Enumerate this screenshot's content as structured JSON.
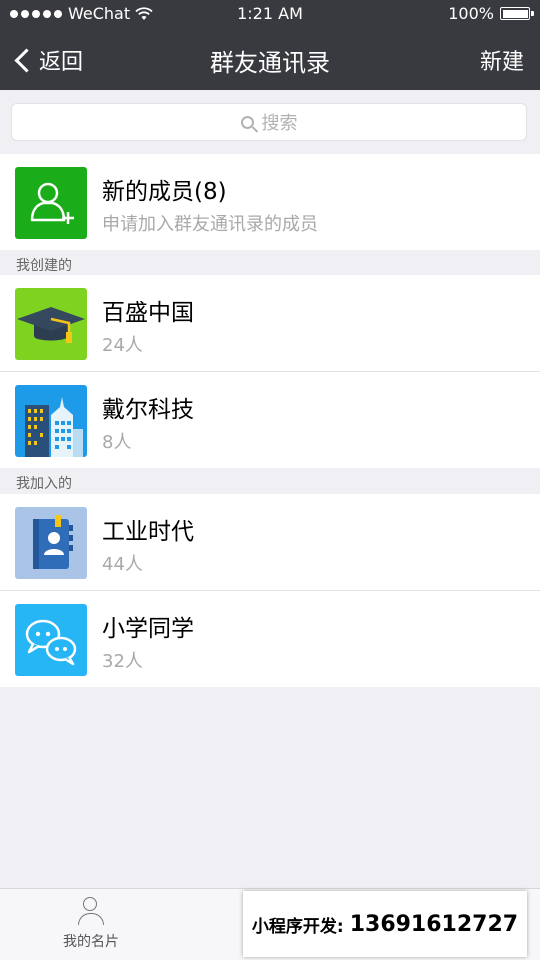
{
  "status": {
    "carrier": "WeChat",
    "time": "1:21 AM",
    "battery": "100%"
  },
  "nav": {
    "back": "返回",
    "title": "群友通讯录",
    "new": "新建"
  },
  "search": {
    "placeholder": "搜索"
  },
  "new_members": {
    "title": "新的成员(8)",
    "subtitle": "申请加入群友通讯录的成员",
    "icon": "add-person-icon",
    "color": "#1aad19"
  },
  "sections": {
    "created": {
      "label": "我创建的",
      "items": [
        {
          "name": "百盛中国",
          "count": "24人",
          "icon": "graduation-cap-icon",
          "color": "#7ed321"
        },
        {
          "name": "戴尔科技",
          "count": "8人",
          "icon": "city-buildings-icon",
          "color": "#1e9be8"
        }
      ]
    },
    "joined": {
      "label": "我加入的",
      "items": [
        {
          "name": "工业时代",
          "count": "44人",
          "icon": "contact-book-icon",
          "color": "#a9c4e6"
        },
        {
          "name": "小学同学",
          "count": "32人",
          "icon": "chat-bubbles-icon",
          "color": "#26b5f5"
        }
      ]
    }
  },
  "tabbar": {
    "my_card": "我的名片"
  },
  "promo": {
    "label": "小程序开发:",
    "phone": "13691612727"
  }
}
